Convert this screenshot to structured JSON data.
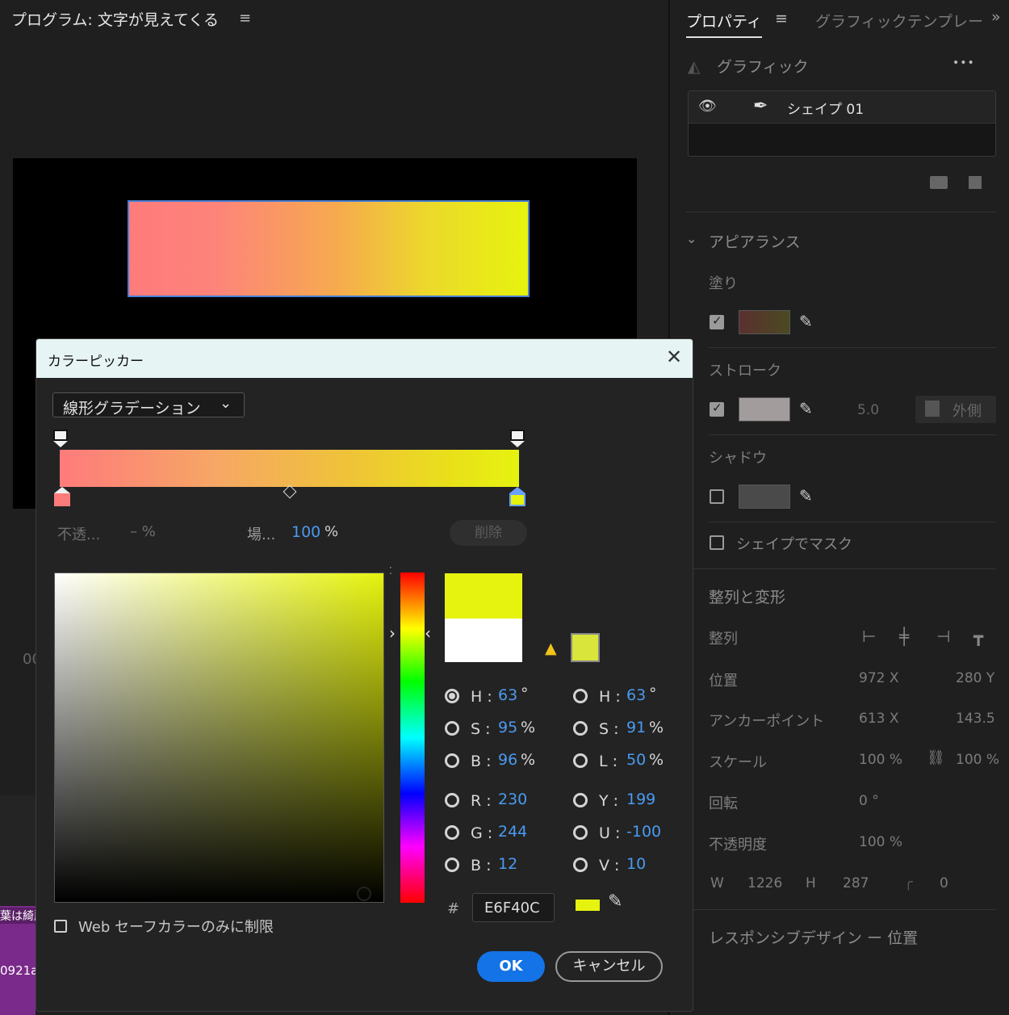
{
  "program": {
    "title": "プログラム: 文字が見えてくる",
    "menu_glyph": "≡",
    "timecode_fragment": "00",
    "clip_label_1": "葉は綺麗",
    "clip_label_2": "0921a"
  },
  "properties": {
    "tab_properties": "プロパティ",
    "tab_menu": "≡",
    "tab_graphics_templates": "グラフィックテンプレー",
    "tab_overflow": "»",
    "graphic_header": "グラフィック",
    "more": "•••",
    "layer_name": "シェイプ 01",
    "appearance": "アピアランス",
    "fill": "塗り",
    "stroke": "ストローク",
    "stroke_width": "5.0",
    "stroke_position": "外側",
    "shadow": "シャドウ",
    "shape_mask": "シェイプでマスク",
    "align_transform": "整列と変形",
    "align": "整列",
    "position": "位置",
    "position_x": "972 X",
    "position_y": "280 Y",
    "anchor_point": "アンカーポイント",
    "anchor_x": "613 X",
    "anchor_y": "143.5",
    "scale": "スケール",
    "scale_x": "100 %",
    "scale_y": "100 %",
    "rotation": "回転",
    "rotation_value": "0 °",
    "opacity": "不透明度",
    "opacity_value": "100 %",
    "w_label": "W",
    "w_value": "1226",
    "h_label": "H",
    "h_value": "287",
    "corner_value": "0",
    "responsive": "レスポンシブデザイン ー 位置",
    "colors": {
      "fill_swatch": "#4a3a2a",
      "stroke_swatch": "#a39c9c",
      "shadow_swatch": "#4a4a4a"
    }
  },
  "dialog": {
    "title": "カラーピッカー",
    "close": "✕",
    "gradient_type": "線形グラデーション",
    "opacity_label": "不透...",
    "opacity_value": "– %",
    "location_label": "場...",
    "location_value": "100",
    "location_unit": "%",
    "delete": "削除",
    "hsb": {
      "h_label": "H :",
      "h_value": "63",
      "h_unit": "°",
      "s_label": "S :",
      "s_value": "95",
      "s_unit": "%",
      "b_label": "B :",
      "b_value": "96",
      "b_unit": "%"
    },
    "hsl": {
      "h_label": "H :",
      "h_value": "63",
      "h_unit": "°",
      "s_label": "S :",
      "s_value": "91",
      "s_unit": "%",
      "l_label": "L :",
      "l_value": "50",
      "l_unit": "%"
    },
    "rgb": {
      "r_label": "R :",
      "r_value": "230",
      "g_label": "G :",
      "g_value": "244",
      "b_label": "B :",
      "b_value": "12"
    },
    "yuv": {
      "y_label": "Y :",
      "y_value": "199",
      "u_label": "U :",
      "u_value": "-100",
      "v_label": "V :",
      "v_value": "10"
    },
    "hex_hash": "#",
    "hex_value": "E6F40C",
    "websafe_label": "Web セーフカラーのみに制限",
    "ok": "OK",
    "cancel": "キャンセル",
    "colors": {
      "new_color": "#e6f30e",
      "old_color": "#ffffff",
      "start_stop": "#fe7b7c",
      "end_stop": "#e6f30e",
      "accent": "#1473e6"
    }
  }
}
